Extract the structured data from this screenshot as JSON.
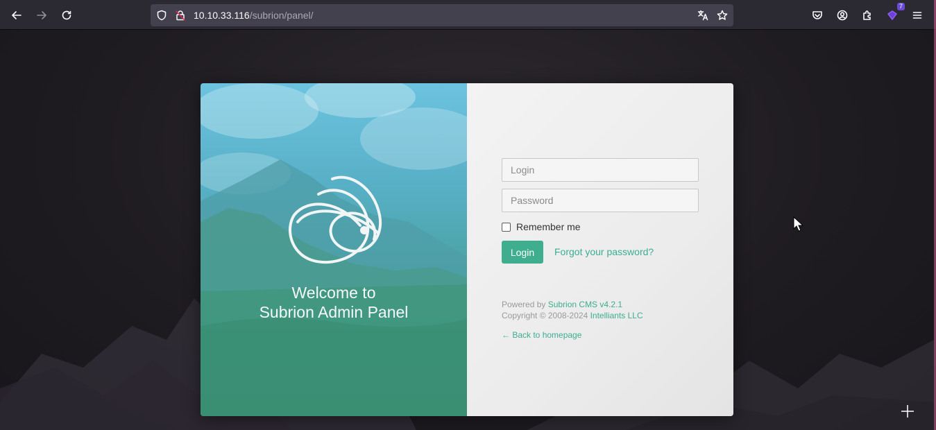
{
  "browser": {
    "url_host": "10.10.33.116",
    "url_path": "/subrion/panel/",
    "extensions_badge": "7",
    "icons": [
      "back-icon",
      "forward-icon",
      "reload-icon",
      "shield-icon",
      "insecure-lock-icon",
      "translate-icon",
      "bookmark-star-icon",
      "pocket-icon",
      "account-icon",
      "extensions-icon",
      "addon-icon",
      "menu-icon"
    ]
  },
  "panel": {
    "welcome_line1": "Welcome to",
    "welcome_line2": "Subrion Admin Panel",
    "login_placeholder": "Login",
    "password_placeholder": "Password",
    "remember_label": "Remember me",
    "login_button": "Login",
    "forgot_link": "Forgot your password?",
    "powered_prefix": "Powered by ",
    "powered_link": "Subrion CMS v4.2.1",
    "copyright_prefix": "Copyright © 2008-2024 ",
    "copyright_link": "Intelliants LLC",
    "back_link": "← Back to homepage"
  },
  "colors": {
    "accent": "#3fae8e",
    "browser_toolbar": "#2b2a33",
    "urlbar": "#42414d",
    "page_background": "#1f1c21"
  }
}
